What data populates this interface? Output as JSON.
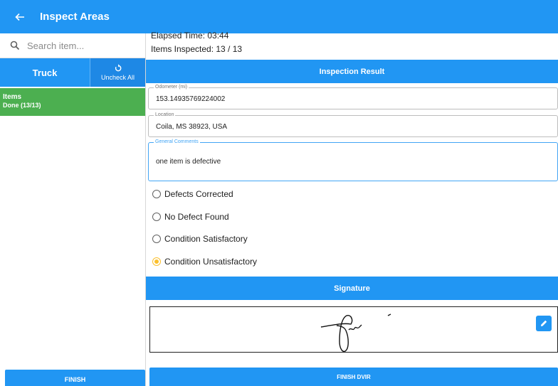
{
  "appbar": {
    "title": "Inspect Areas",
    "back_icon": "arrow-left-icon",
    "color": "#2196f3"
  },
  "left": {
    "search": {
      "placeholder": "Search item...",
      "value": "",
      "icon": "search-icon"
    },
    "tabs": {
      "truck_label": "Truck",
      "uncheck_label": "Uncheck All",
      "uncheck_icon": "refresh-icon"
    },
    "items": [
      {
        "title": "Items",
        "status": "Done (13/13)",
        "color": "#4caf50"
      }
    ],
    "finish_label": "FINISH"
  },
  "right": {
    "elapsed_time": "Elapsed Time: 03:44",
    "items_inspected": "Items Inspected: 13 / 13",
    "result_header": "Inspection Result",
    "odometer": {
      "label": "Odometer (mi)",
      "value": "153.14935769224002"
    },
    "location": {
      "label": "Location",
      "value": "Coila, MS 38923, USA"
    },
    "comments": {
      "label": "General Comments",
      "value": "one item is defective"
    },
    "options": [
      {
        "label": "Defects Corrected",
        "selected": false
      },
      {
        "label": "No Defect Found",
        "selected": false
      },
      {
        "label": "Condition Satisfactory",
        "selected": false
      },
      {
        "label": "Condition Unsatisfactory",
        "selected": true
      }
    ],
    "selected_color": "#fbc02d",
    "signature_header": "Signature",
    "edit_icon": "pencil-icon",
    "finish_dvir_label": "FINISH DVIR"
  }
}
